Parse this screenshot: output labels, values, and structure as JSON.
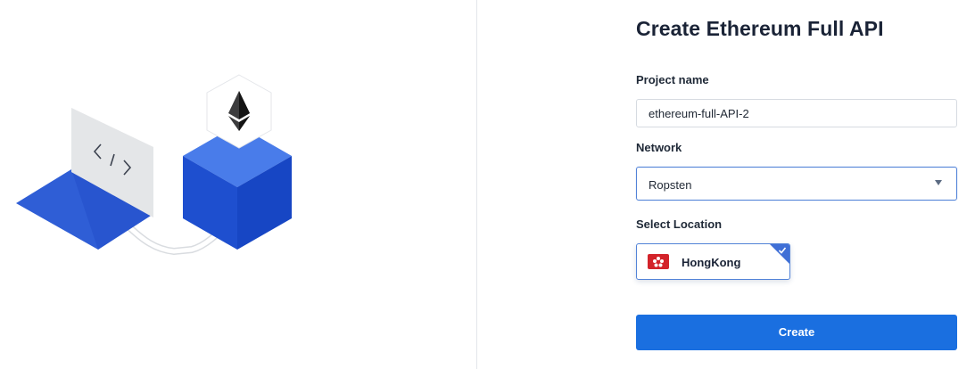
{
  "form": {
    "title": "Create Ethereum Full API",
    "project_name_label": "Project name",
    "project_name_value": "ethereum-full-API-2",
    "network_label": "Network",
    "network_value": "Ropsten",
    "location_label": "Select Location",
    "location_selected": "HongKong",
    "create_label": "Create"
  },
  "illustration": {
    "code_glyph": "‹ / ›",
    "icons": [
      "ethereum-icon",
      "code-icon",
      "blue-cube",
      "blue-plane"
    ]
  },
  "colors": {
    "accent": "#1a6fe0",
    "selected_border": "#5283d8",
    "cube_blue": "#1f4fd1",
    "flag_red": "#d3232a"
  }
}
